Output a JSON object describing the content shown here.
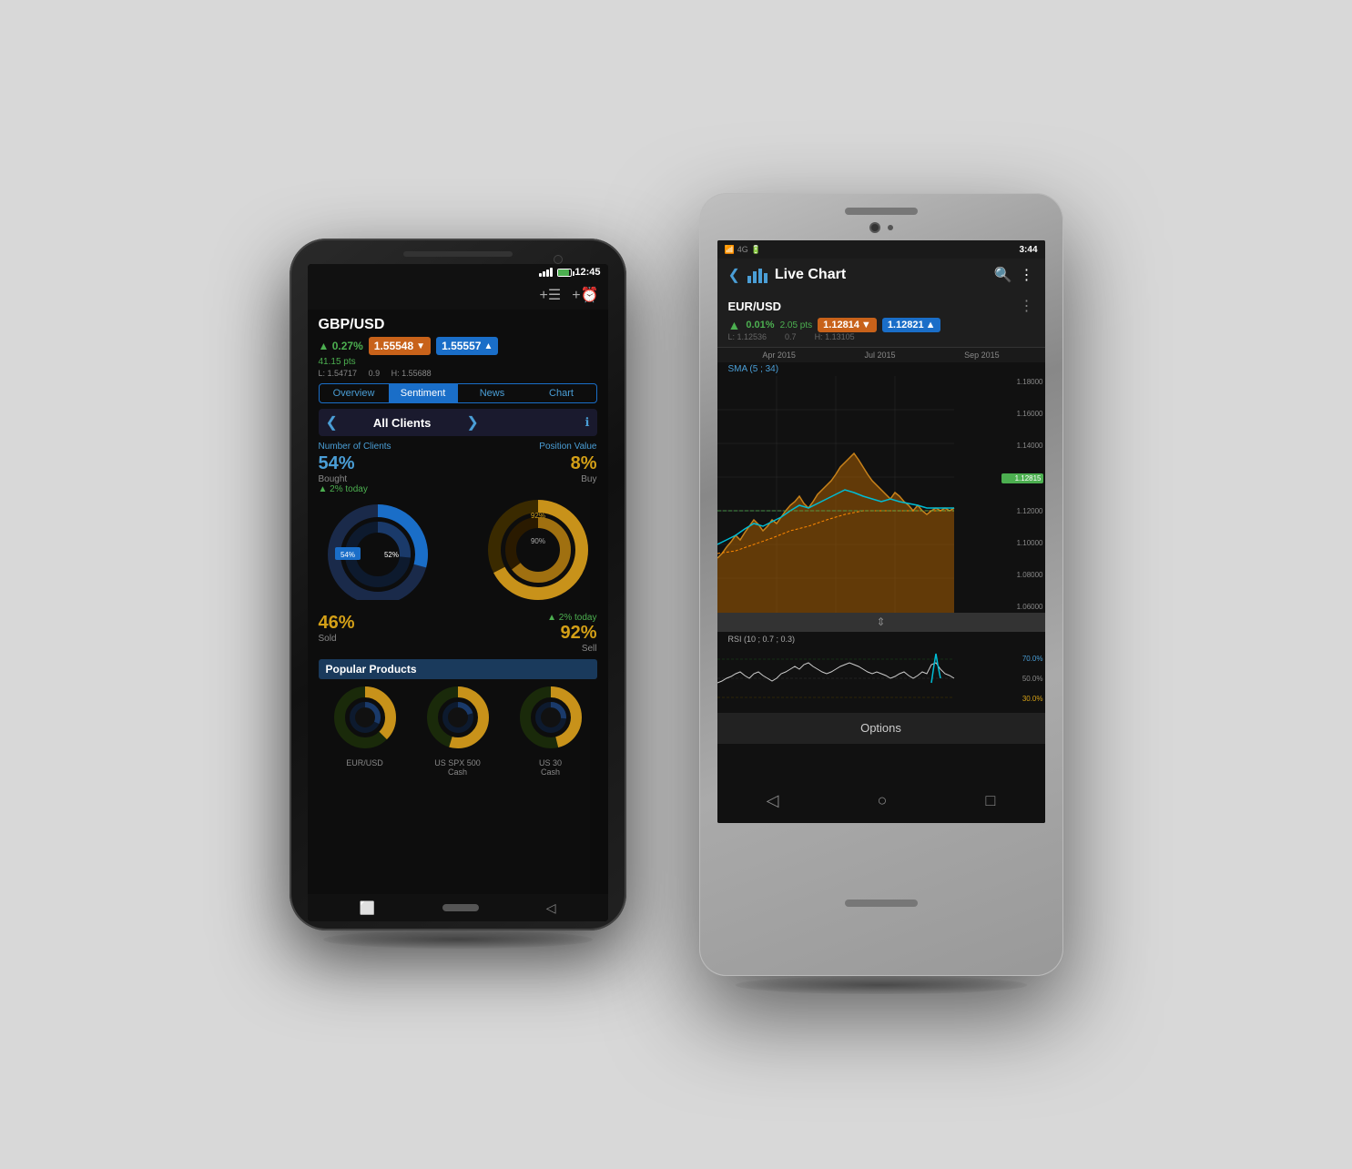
{
  "phone1": {
    "statusbar": {
      "time": "12:45"
    },
    "pair": "GBP/USD",
    "change_pct": "0.27%",
    "change_pts": "41.15 pts",
    "price_sell": "1.55548",
    "price_buy": "1.55557",
    "price_low": "L: 1.54717",
    "price_high": "H: 1.55688",
    "spread": "0.9",
    "tabs": [
      "Overview",
      "Sentiment",
      "News",
      "Chart"
    ],
    "active_tab": "Sentiment",
    "clients_title": "All Clients",
    "num_clients_label": "Number of Clients",
    "position_value_label": "Position Value",
    "bought_pct": "54%",
    "sold_pct": "46%",
    "buy_pct": "8%",
    "sell_pct": "92%",
    "bought_label": "Bought",
    "sold_label": "Sold",
    "buy_label": "Buy",
    "sell_label": "Sell",
    "today_change1": "▲ 2% today",
    "today_change2": "▲ 2% today",
    "inner_ring_pct": "52%",
    "outer_ring_pct1": "92%",
    "outer_ring_pct2": "90%",
    "popular_label": "Popular Products",
    "product1": "EUR/USD",
    "product2": "US SPX 500\nCash",
    "product3": "US 30\nCash"
  },
  "phone2": {
    "statusbar": {
      "time": "3:44",
      "network": "4G"
    },
    "title": "Live Chart",
    "pair": "EUR/USD",
    "change_pct": "0.01%",
    "change_pts": "2.05 pts",
    "price_sell": "1.12814",
    "price_buy": "1.12821",
    "price_low": "L: 1.12536",
    "price_high": "H: 1.13105",
    "spread": "0.7",
    "sma_label": "SMA (5 ; 34)",
    "current_price": "1.12815",
    "chart_dates": [
      "Apr 2015",
      "Jul 2015",
      "Sep 2015"
    ],
    "price_levels": [
      "1.18000",
      "1.16000",
      "1.14000",
      "1.12000",
      "1.10000",
      "1.08000",
      "1.06000"
    ],
    "rsi_label": "RSI (10 ; 0.7 ; 0.3)",
    "rsi_levels": [
      "70.0%",
      "50.0%",
      "30.0%"
    ],
    "options_label": "Options",
    "nav_icons": [
      "◁",
      "○",
      "□"
    ]
  }
}
